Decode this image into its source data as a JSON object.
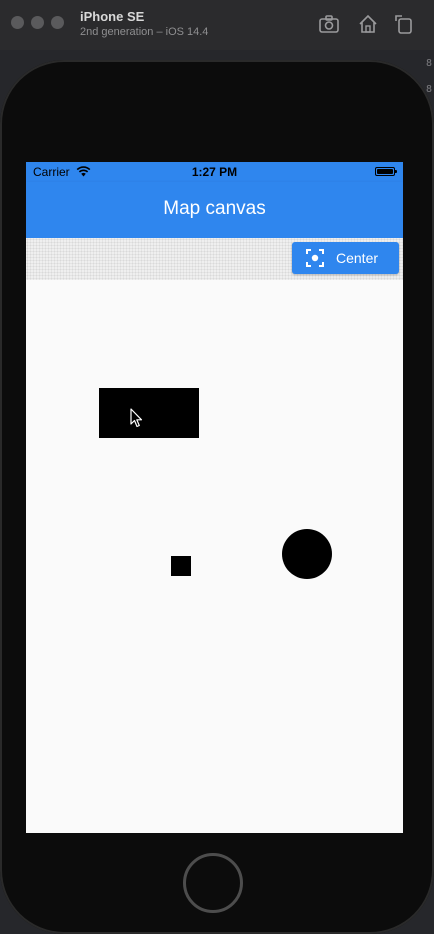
{
  "simulator": {
    "device_name": "iPhone SE",
    "device_subtitle": "2nd generation – iOS 14.4",
    "toolbar_icons": [
      "screenshot-icon",
      "home-icon",
      "rotate-icon"
    ]
  },
  "statusbar": {
    "carrier": "Carrier",
    "time": "1:27 PM"
  },
  "appbar": {
    "title": "Map canvas",
    "color": "#2f86ee"
  },
  "toolbar": {
    "center_label": "Center",
    "center_icon": "center-focus-icon"
  },
  "canvas": {
    "shapes": [
      "rectangle",
      "square",
      "circle"
    ],
    "shape_color": "#000000"
  }
}
